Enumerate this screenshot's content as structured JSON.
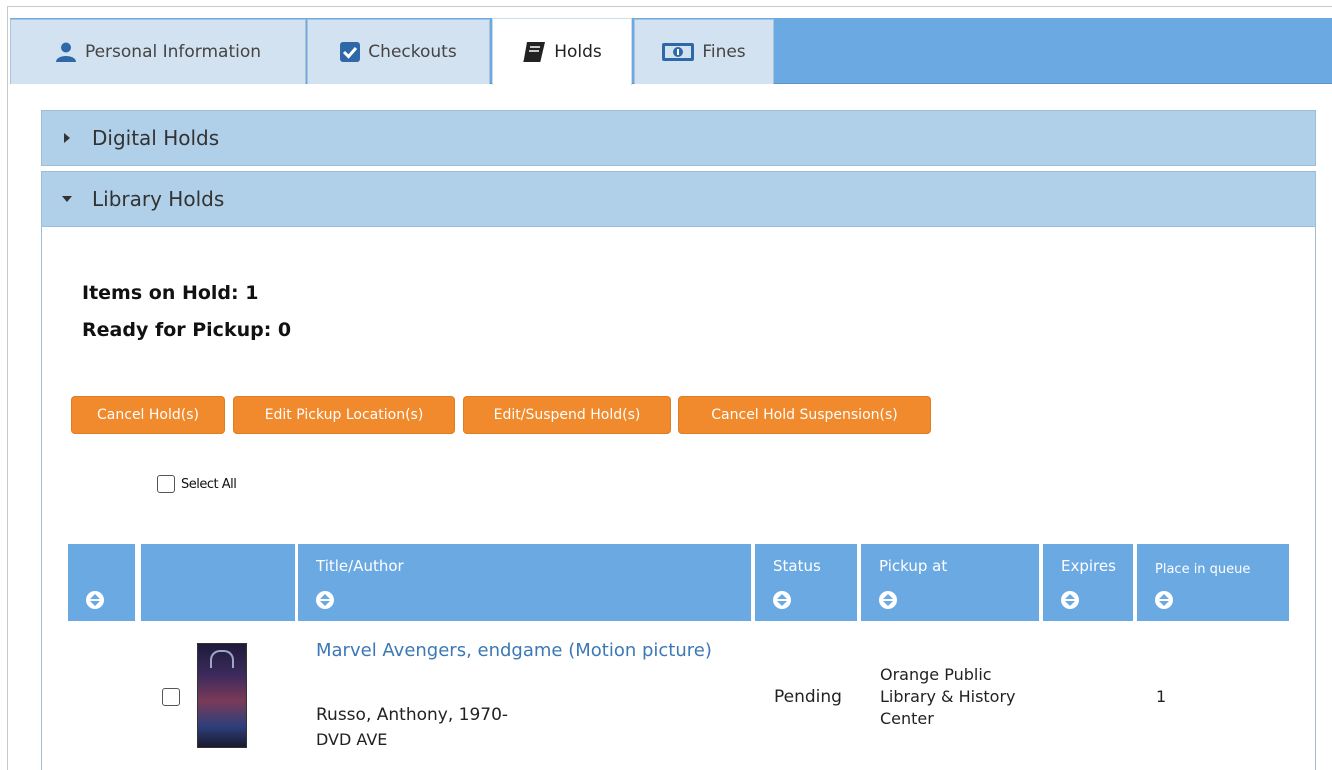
{
  "tabs": [
    {
      "label": "Personal Information",
      "icon": "user-icon"
    },
    {
      "label": "Checkouts",
      "icon": "checkbox-icon"
    },
    {
      "label": "Holds",
      "icon": "book-icon"
    },
    {
      "label": "Fines",
      "icon": "money-icon"
    }
  ],
  "active_tab": "Holds",
  "sections": {
    "digital": {
      "title": "Digital Holds",
      "expanded": false
    },
    "library": {
      "title": "Library Holds",
      "expanded": true
    }
  },
  "summary": {
    "items_on_hold": "Items on Hold: 1",
    "ready_for_pickup": "Ready for Pickup: 0"
  },
  "actions": {
    "cancel": "Cancel Hold(s)",
    "edit_pickup": "Edit Pickup Location(s)",
    "edit_suspend": "Edit/Suspend Hold(s)",
    "cancel_suspension": "Cancel Hold Suspension(s)"
  },
  "select_all_label": "Select All",
  "table": {
    "headers": {
      "title": "Title/Author",
      "status": "Status",
      "pickup": "Pickup at",
      "expires": "Expires",
      "queue": "Place in queue"
    },
    "rows": [
      {
        "title": "Marvel Avengers, endgame (Motion picture)",
        "author": "Russo, Anthony, 1970-",
        "format": "DVD AVE",
        "status": "Pending",
        "pickup": "Orange Public Library & History Center",
        "expires": "",
        "queue": "1"
      }
    ]
  },
  "colors": {
    "tab_bar": "#6aa9e2",
    "panel_header": "#b0cfe8",
    "button": "#f08a2c",
    "link": "#3c78b5"
  }
}
